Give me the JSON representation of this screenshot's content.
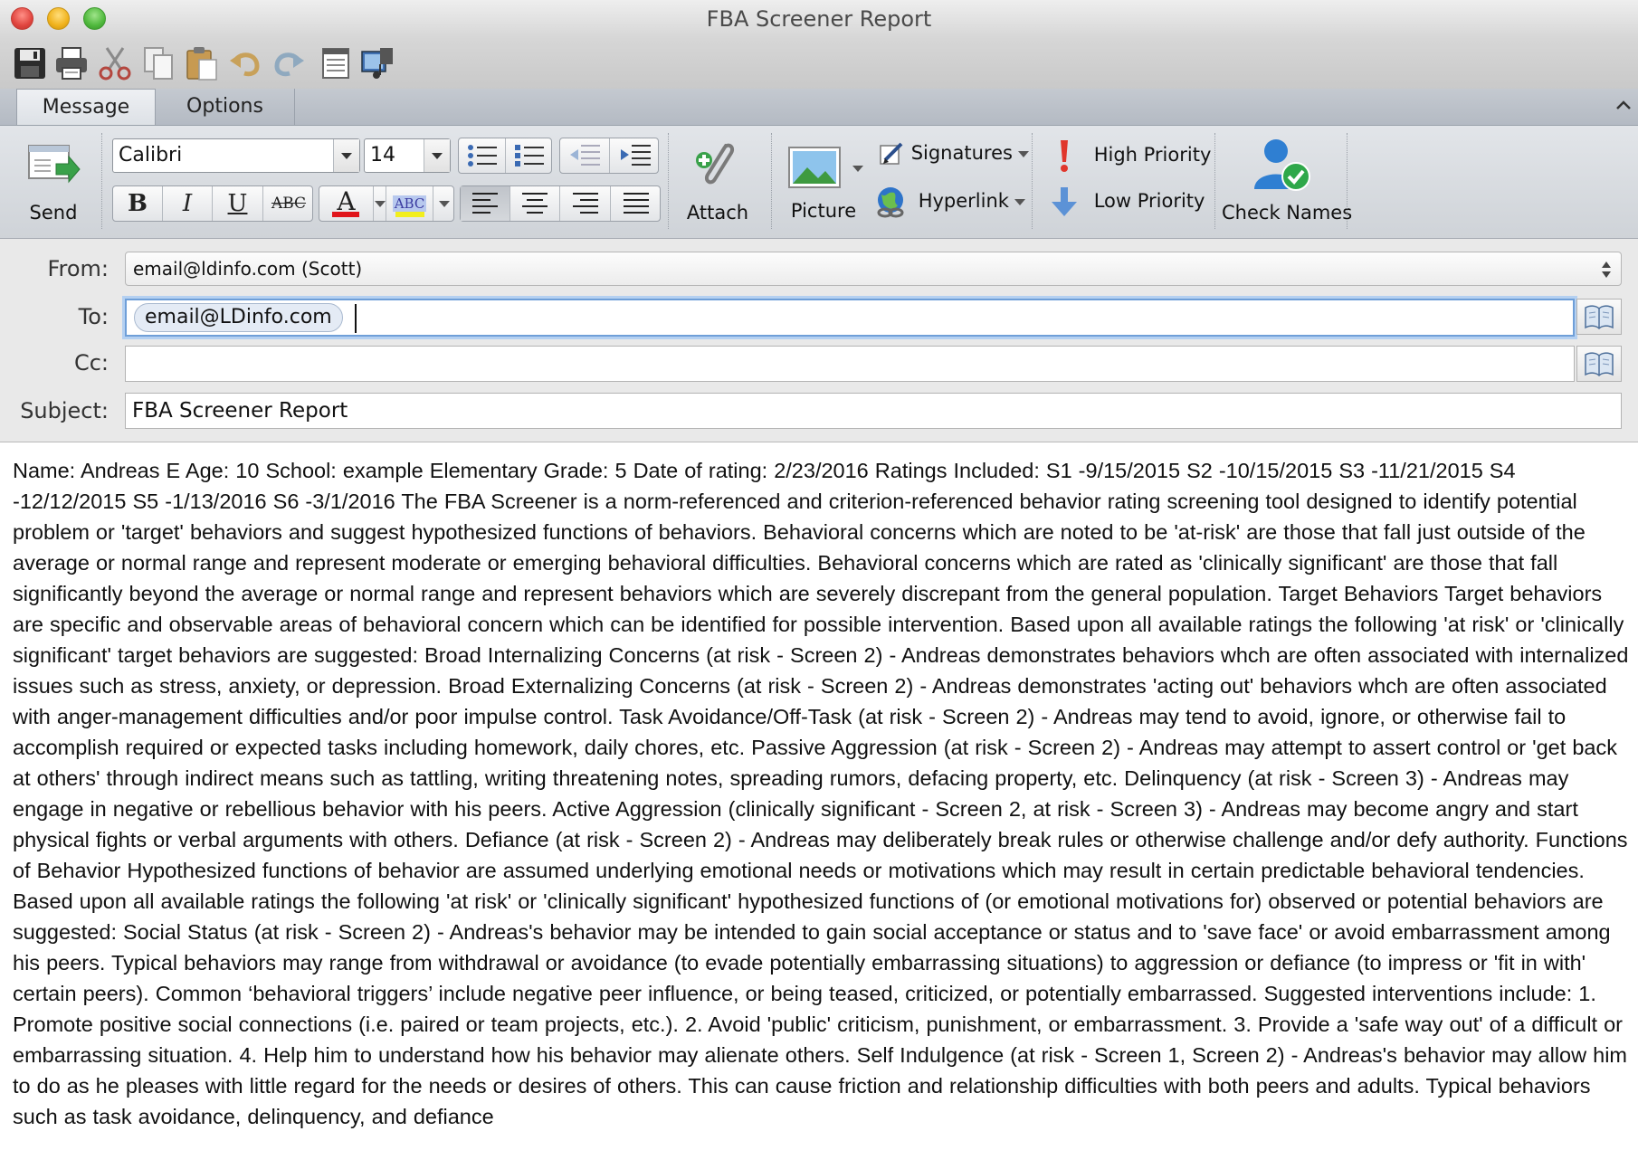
{
  "window": {
    "title": "FBA Screener Report"
  },
  "quick_toolbar": {
    "icons": [
      "save-icon",
      "print-icon",
      "cut-icon",
      "copy-icon",
      "paste-icon",
      "undo-icon",
      "redo-icon",
      "form-icon",
      "media-browser-icon"
    ]
  },
  "tabs": [
    {
      "label": "Message",
      "active": true
    },
    {
      "label": "Options",
      "active": false
    }
  ],
  "ribbon": {
    "send_label": "Send",
    "font_name": "Calibri",
    "font_size": "14",
    "attach_label": "Attach",
    "picture_label": "Picture",
    "signatures_label": "Signatures",
    "hyperlink_label": "Hyperlink",
    "high_priority_label": "High Priority",
    "low_priority_label": "Low Priority",
    "check_names_label": "Check Names",
    "bold": "B",
    "italic": "I",
    "underline": "U",
    "strike": "ABC",
    "font_color_glyph": "A",
    "highlight_glyph": "ABC"
  },
  "headers": {
    "from_label": "From:",
    "from_value": "email@ldinfo.com (Scott)",
    "to_label": "To:",
    "to_recipient": "email@LDinfo.com",
    "cc_label": "Cc:",
    "cc_value": "",
    "subject_label": "Subject:",
    "subject_value": "FBA Screener Report"
  },
  "message_body": "Name: Andreas E Age: 10 School: example Elementary Grade: 5 Date of rating: 2/23/2016 Ratings Included: S1 -9/15/2015 S2 -10/15/2015 S3 -11/21/2015 S4 -12/12/2015 S5 -1/13/2016 S6 -3/1/2016 The FBA Screener is a norm-referenced and criterion-referenced behavior rating screening tool designed to identify potential problem or 'target' behaviors and suggest hypothesized functions of behaviors. Behavioral concerns which are noted to be 'at-risk' are those that fall just outside of the average or normal range and represent moderate or emerging behavioral difficulties. Behavioral concerns which are rated as 'clinically significant' are those that fall significantly beyond the average or normal range and represent behaviors which are severely discrepant from the general population. Target Behaviors Target behaviors are specific and observable areas of behavioral concern which can be identified for possible intervention. Based upon all available ratings the following 'at risk' or 'clinically significant' target behaviors are suggested: Broad Internalizing Concerns (at risk - Screen 2) - Andreas demonstrates behaviors whch are often associated with internalized issues such as stress, anxiety, or depression. Broad Externalizing Concerns (at risk - Screen 2) - Andreas demonstrates 'acting out' behaviors whch are often associated with anger-management difficulties and/or poor impulse control. Task Avoidance/Off-Task (at risk - Screen 2) - Andreas may tend to avoid, ignore, or otherwise fail to accomplish required or expected tasks including homework, daily chores, etc. Passive Aggression (at risk - Screen 2) - Andreas may attempt to assert control or 'get back at others' through indirect means such as tattling, writing threatening notes, spreading rumors, defacing property, etc. Delinquency (at risk - Screen 3) - Andreas may engage in negative or rebellious behavior with his peers. Active Aggression (clinically significant - Screen 2, at risk - Screen 3) - Andreas may become angry and start physical fights or verbal arguments with others. Defiance (at risk - Screen 2) - Andreas may deliberately break rules or otherwise challenge and/or defy authority. Functions of Behavior Hypothesized functions of behavior are assumed underlying emotional needs or motivations which may result in certain predictable behavioral tendencies. Based upon all available ratings the following 'at risk' or 'clinically significant' hypothesized functions of (or emotional motivations for) observed or potential behaviors are suggested: Social Status (at risk - Screen 2) - Andreas's behavior may be intended to gain social acceptance or status and to 'save face' or avoid embarrassment among his peers. Typical behaviors may range from withdrawal or avoidance (to evade potentially embarrassing situations) to aggression or defiance (to impress or 'fit in with' certain peers). Common ‘behavioral triggers’ include negative peer influence, or being teased, criticized, or potentially embarrassed. Suggested interventions include: 1. Promote positive social connections (i.e. paired or team projects, etc.). 2. Avoid 'public' criticism, punishment, or embarrassment. 3. Provide a 'safe way out' of a difficult or embarrassing situation. 4. Help him to understand how his behavior may alienate others. Self Indulgence (at risk - Screen 1, Screen 2) - Andreas's behavior may allow him to do as he pleases with little regard for the needs or desires of others. This can cause friction and relationship difficulties with both peers and adults. Typical behaviors such as task avoidance, delinquency, and defiance"
}
